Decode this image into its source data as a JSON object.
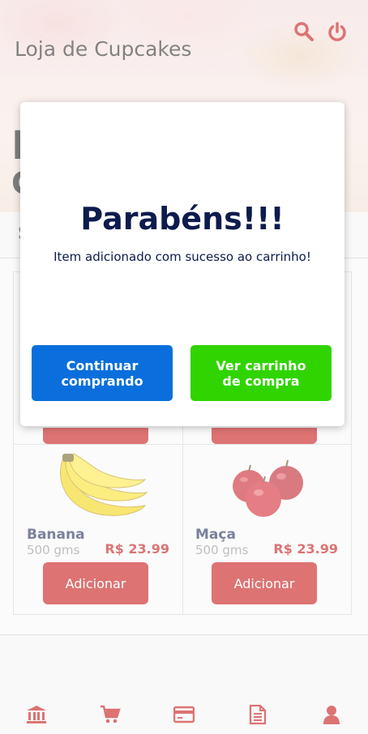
{
  "header": {
    "title": "Loja de Cupcakes",
    "icons": [
      "search-icon",
      "power-icon"
    ]
  },
  "hero": {
    "partial_line1": "L",
    "partial_line2": "C",
    "partial_section": "S"
  },
  "products": [
    {
      "name": "Banana",
      "quantity": "500 gms",
      "price": "R$ 23.99",
      "button": "Adicionar"
    },
    {
      "name": "Maça",
      "quantity": "500 gms",
      "price": "R$ 23.99",
      "button": "Adicionar"
    }
  ],
  "modal": {
    "title": "Parabéns!!!",
    "message": "Item adicionado com sucesso ao carrinho!",
    "continue_button": "Continuar comprando",
    "cart_button": "Ver carrinho de compra"
  },
  "bottom_nav": {
    "items": [
      "bank-icon",
      "cart-icon",
      "credit-card-icon",
      "document-icon",
      "user-icon"
    ]
  },
  "colors": {
    "accent_red": "#c10000",
    "navy_text": "#0d1b4d",
    "continue_blue": "#0a6fdc",
    "cart_green": "#30d400"
  }
}
